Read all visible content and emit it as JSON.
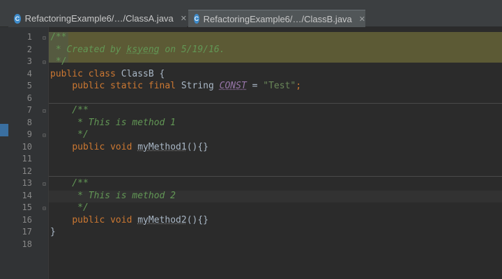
{
  "tabs": [
    {
      "label": "RefactoringExample6/…/ClassA.java",
      "icon": "c-class-icon",
      "close": "✕"
    },
    {
      "label": "RefactoringExample6/…/ClassB.java",
      "icon": "c-class-icon",
      "close": "✕"
    }
  ],
  "line_numbers": [
    "1",
    "2",
    "3",
    "4",
    "5",
    "6",
    "7",
    "8",
    "9",
    "10",
    "11",
    "12",
    "13",
    "14",
    "15",
    "16",
    "17",
    "18"
  ],
  "code": {
    "l1": "/**",
    "l2a": " * Created by ",
    "l2b": "ksyeng",
    "l2c": " on 5/19/16.",
    "l3": " */",
    "l4a": "public class",
    "l4b": " ClassB {",
    "l5a": "    ",
    "l5b": "public static final",
    "l5c": " String ",
    "l5d": "CONST",
    "l5e": " = ",
    "l5f": "\"Test\"",
    "l5g": ";",
    "l7": "    /**",
    "l8": "     * This is method 1",
    "l9": "     */",
    "l10a": "    ",
    "l10b": "public void",
    "l10c": " ",
    "l10d": "myMethod1",
    "l10e": "(){}",
    "l13": "    /**",
    "l14": "     * This is method 2",
    "l15": "     */",
    "l16a": "    ",
    "l16b": "public void",
    "l16c": " ",
    "l16d": "myMethod2",
    "l16e": "(){}",
    "l17": "}"
  },
  "colors": {
    "background": "#2b2b2b",
    "keyword": "#cc7832",
    "comment": "#629755",
    "string": "#6a8759",
    "constant": "#9876aa",
    "text": "#a9b7c6"
  }
}
